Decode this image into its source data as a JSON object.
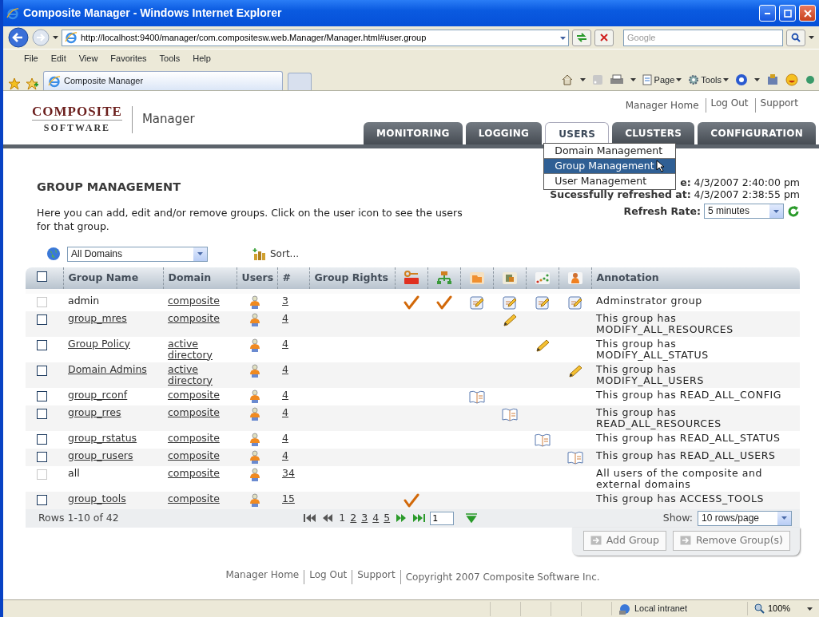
{
  "window": {
    "title": "Composite Manager - Windows Internet Explorer"
  },
  "address_bar": {
    "url": "http://localhost:9400/manager/com.compositesw.web.Manager/Manager.html#user.group",
    "search_placeholder": "Google"
  },
  "menu": [
    "File",
    "Edit",
    "View",
    "Favorites",
    "Tools",
    "Help"
  ],
  "browser_tab": "Composite Manager",
  "command_bar": [
    "Page",
    "Tools"
  ],
  "page": {
    "logo": {
      "line1": "COMPOSITE",
      "line2": "SOFTWARE"
    },
    "product": "Manager",
    "top_links": [
      "Manager Home",
      "Log Out",
      "Support"
    ],
    "nav_tabs": [
      {
        "label": "MONITORING",
        "selected": false
      },
      {
        "label": "LOGGING",
        "selected": false
      },
      {
        "label": "USERS",
        "selected": true
      },
      {
        "label": "CLUSTERS",
        "selected": false
      },
      {
        "label": "CONFIGURATION",
        "selected": false
      }
    ],
    "dropdown": [
      {
        "label": "Domain Management",
        "selected": false
      },
      {
        "label": "Group Management",
        "selected": true
      },
      {
        "label": "User Management",
        "selected": false
      }
    ],
    "heading": "GROUP MANAGEMENT",
    "description": "Here you can add, edit and/or remove groups. Click on the user icon to see the users for that group.",
    "status": [
      {
        "label": "e:",
        "value": "4/3/2007 2:40:00 pm"
      },
      {
        "label": "Sucessfully refreshed at:",
        "value": "4/3/2007 2:38:55 pm"
      }
    ],
    "refresh": {
      "label": "Refresh Rate:",
      "value": "5 minutes"
    },
    "domain_filter": "All Domains",
    "sort_link": "Sort...",
    "table": {
      "select_all": false,
      "columns": [
        "Group Name",
        "Domain",
        "Users",
        "#",
        "Group Rights",
        "Annotation"
      ],
      "rows": [
        {
          "checked": false,
          "disabled": true,
          "name": "admin",
          "linked": false,
          "domain": "composite",
          "members": "3",
          "rights": [
            {
              "kind": "check"
            },
            {
              "kind": "check"
            },
            {
              "kind": "full"
            },
            {
              "kind": "full"
            },
            {
              "kind": "full"
            },
            {
              "kind": "full"
            }
          ],
          "annotation": "Adminstrator group"
        },
        {
          "checked": false,
          "disabled": false,
          "name": "group_mres",
          "linked": true,
          "domain": "composite",
          "members": "4",
          "rights": [
            {
              "kind": "none"
            },
            {
              "kind": "none"
            },
            {
              "kind": "none"
            },
            {
              "kind": "modify"
            },
            {
              "kind": "none"
            },
            {
              "kind": "none"
            }
          ],
          "annotation": "This group has MODIFY_ALL_RESOURCES"
        },
        {
          "checked": false,
          "disabled": false,
          "name": "Group Policy",
          "linked": true,
          "domain": "active directory",
          "members": "4",
          "rights": [
            {
              "kind": "none"
            },
            {
              "kind": "none"
            },
            {
              "kind": "none"
            },
            {
              "kind": "none"
            },
            {
              "kind": "modify"
            },
            {
              "kind": "none"
            }
          ],
          "annotation": "This group has MODIFY_ALL_STATUS"
        },
        {
          "checked": false,
          "disabled": false,
          "name": "Domain Admins",
          "linked": true,
          "domain": "active directory",
          "members": "4",
          "rights": [
            {
              "kind": "none"
            },
            {
              "kind": "none"
            },
            {
              "kind": "none"
            },
            {
              "kind": "none"
            },
            {
              "kind": "none"
            },
            {
              "kind": "modify"
            }
          ],
          "annotation": "This group has MODIFY_ALL_USERS"
        },
        {
          "checked": false,
          "disabled": false,
          "name": "group_rconf",
          "linked": true,
          "domain": "composite",
          "members": "4",
          "rights": [
            {
              "kind": "none"
            },
            {
              "kind": "none"
            },
            {
              "kind": "read"
            },
            {
              "kind": "none"
            },
            {
              "kind": "none"
            },
            {
              "kind": "none"
            }
          ],
          "annotation": "This group has READ_ALL_CONFIG"
        },
        {
          "checked": false,
          "disabled": false,
          "name": "group_rres",
          "linked": true,
          "domain": "composite",
          "members": "4",
          "rights": [
            {
              "kind": "none"
            },
            {
              "kind": "none"
            },
            {
              "kind": "none"
            },
            {
              "kind": "read"
            },
            {
              "kind": "none"
            },
            {
              "kind": "none"
            }
          ],
          "annotation": "This group has READ_ALL_RESOURCES"
        },
        {
          "checked": false,
          "disabled": false,
          "name": "group_rstatus",
          "linked": true,
          "domain": "composite",
          "members": "4",
          "rights": [
            {
              "kind": "none"
            },
            {
              "kind": "none"
            },
            {
              "kind": "none"
            },
            {
              "kind": "none"
            },
            {
              "kind": "read"
            },
            {
              "kind": "none"
            }
          ],
          "annotation": "This group has READ_ALL_STATUS"
        },
        {
          "checked": false,
          "disabled": false,
          "name": "group_rusers",
          "linked": true,
          "domain": "composite",
          "members": "4",
          "rights": [
            {
              "kind": "none"
            },
            {
              "kind": "none"
            },
            {
              "kind": "none"
            },
            {
              "kind": "none"
            },
            {
              "kind": "none"
            },
            {
              "kind": "read"
            }
          ],
          "annotation": "This group has READ_ALL_USERS"
        },
        {
          "checked": false,
          "disabled": true,
          "name": "all",
          "linked": false,
          "domain": "composite",
          "members": "34",
          "rights": [
            {
              "kind": "none"
            },
            {
              "kind": "none"
            },
            {
              "kind": "none"
            },
            {
              "kind": "none"
            },
            {
              "kind": "none"
            },
            {
              "kind": "none"
            }
          ],
          "annotation": "All users of the composite and external domains"
        },
        {
          "checked": false,
          "disabled": false,
          "name": "group_tools",
          "linked": true,
          "domain": "composite",
          "members": "15",
          "rights": [
            {
              "kind": "check"
            },
            {
              "kind": "none"
            },
            {
              "kind": "none"
            },
            {
              "kind": "none"
            },
            {
              "kind": "none"
            },
            {
              "kind": "none"
            }
          ],
          "annotation": "This group has ACCESS_TOOLS"
        }
      ]
    },
    "pager": {
      "summary": "Rows 1-10 of 42",
      "pages": [
        {
          "label": "1",
          "selected": true
        },
        {
          "label": "2",
          "selected": false
        },
        {
          "label": "3",
          "selected": false
        },
        {
          "label": "4",
          "selected": false
        },
        {
          "label": "5",
          "selected": false
        }
      ],
      "page_input": "1",
      "show_label": "Show:",
      "show_value": "10 rows/page"
    },
    "buttons": [
      "Add Group",
      "Remove Group(s)"
    ],
    "footer": {
      "links": [
        "Manager Home",
        "Log Out",
        "Support"
      ],
      "copyright": "Copyright 2007 Composite Software Inc."
    }
  },
  "status_bar": {
    "zone": "Local intranet",
    "zoom": "100%"
  }
}
